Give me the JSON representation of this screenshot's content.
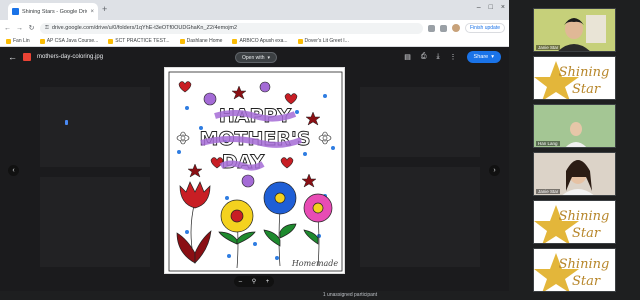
{
  "browser": {
    "tab_title": "Shining Stars - Google Drive",
    "tab_close": "×",
    "new_tab": "+",
    "window_controls": [
      "–",
      "□",
      "×"
    ],
    "nav": [
      "←",
      "→",
      "↻"
    ],
    "lock": "⚿",
    "url": "drive.google.com/drive/u/0/folders/1qYhE-t3eOTf0OUDGhaKn_Z2/4emojm2",
    "finish_update": "Finish update",
    "bookmarks": [
      {
        "label": "Fan Lin"
      },
      {
        "label": "AP CSA Java Course..."
      },
      {
        "label": "SCT PRACTICE TEST..."
      },
      {
        "label": "Dashlane Home"
      },
      {
        "label": "ARBICO Apush exa..."
      },
      {
        "label": "Dover's Lit Greet I..."
      }
    ]
  },
  "preview": {
    "back": "←",
    "file_name": "mothers-day-coloring.jpg",
    "open_with": "Open with",
    "open_with_caret": "▾",
    "tools": [
      "▤",
      "⎙",
      "⤓",
      "⋮"
    ],
    "share_label": "Share",
    "share_caret": "▾",
    "prev_arrow": "‹",
    "next_arrow": "›",
    "zoom": {
      "minus": "–",
      "search": "⚲",
      "plus": "+"
    }
  },
  "coloring_page": {
    "line1": "HAPPY",
    "line2": "MOTHER'S",
    "line3": "DAY",
    "signature": "Homemade",
    "colors": {
      "purple": "#a46bd6",
      "red": "#c81e24",
      "darkred": "#8a0f14",
      "yellow": "#f4d21f",
      "blue": "#1f5fd6",
      "pink": "#e84cb5",
      "green": "#1e8a2e",
      "dot_blue": "#2f7de1"
    }
  },
  "meeting": {
    "tiles": [
      {
        "type": "video",
        "name": "Janie Star"
      },
      {
        "type": "logo",
        "text1": "Shining",
        "text2": "Star"
      },
      {
        "type": "video",
        "name": "Han Lang"
      },
      {
        "type": "video",
        "name": "Janie Star"
      },
      {
        "type": "logo",
        "text1": "Shining",
        "text2": "Star"
      },
      {
        "type": "logo",
        "text1": "Shining",
        "text2": "Star"
      }
    ],
    "bottom_message": "1 unassigned participant"
  }
}
